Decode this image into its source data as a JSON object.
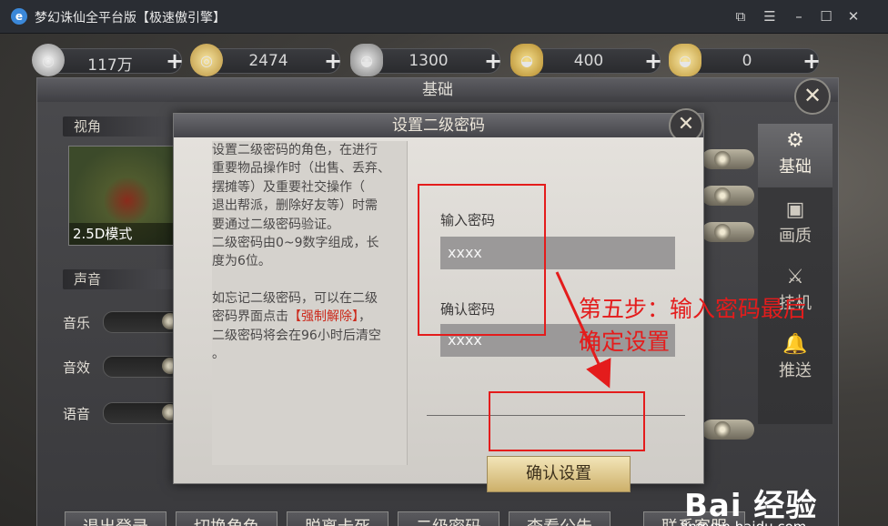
{
  "window": {
    "title": "梦幻诛仙全平台版【极速傲引擎】",
    "icon": "app-logo-icon"
  },
  "currencies": [
    {
      "name": "silver-coin-icon",
      "value": "117万"
    },
    {
      "name": "gold-coin-icon",
      "value": "2474"
    },
    {
      "name": "silver-ingot-icon",
      "value": "1300"
    },
    {
      "name": "gold-ingot-icon",
      "value": "400"
    },
    {
      "name": "yuanbao-icon",
      "value": "0"
    }
  ],
  "settings": {
    "title": "基础",
    "view_section": "视角",
    "view_mode": "2.5D模式",
    "sound_section": "声音",
    "sound_items": [
      "音乐",
      "音效",
      "语音"
    ],
    "side_tabs": [
      {
        "icon": "gear-icon",
        "label": "基础"
      },
      {
        "icon": "monitor-icon",
        "label": "画质"
      },
      {
        "icon": "sword-icon",
        "label": "挂机"
      },
      {
        "icon": "bell-icon",
        "label": "推送"
      }
    ],
    "bottom_buttons": [
      "退出登录",
      "切换角色",
      "脱离卡死",
      "二级密码",
      "查看公告",
      "联系客服"
    ]
  },
  "dialog": {
    "title": "设置二级密码",
    "description_lines": [
      "设置二级密码的角色，在进行",
      "重要物品操作时（出售、丢弃、",
      "摆摊等）及重要社交操作（",
      "退出帮派，删除好友等）时需",
      "要通过二级密码验证。",
      "二级密码由0~9数字组成，长",
      "度为6位。"
    ],
    "forget_line1": "如忘记二级密码，可以在二级",
    "forget_line2_prefix": "密码界面点击",
    "forget_line2_link": "【强制解除】",
    "forget_line2_suffix": "，",
    "forget_line3": "二级密码将会在96小时后清空",
    "forget_line4": "。",
    "password_label": "输入密码",
    "password_value": "xxxx",
    "confirm_label": "确认密码",
    "confirm_value": "xxxx",
    "confirm_button": "确认设置"
  },
  "annotation": {
    "step_line1": "第五步：输入密码最后",
    "step_line2": "确定设置",
    "color": "#e41c1c"
  },
  "watermark": {
    "logo": "Bai 经验",
    "url": "jingyan.baidu.com"
  }
}
